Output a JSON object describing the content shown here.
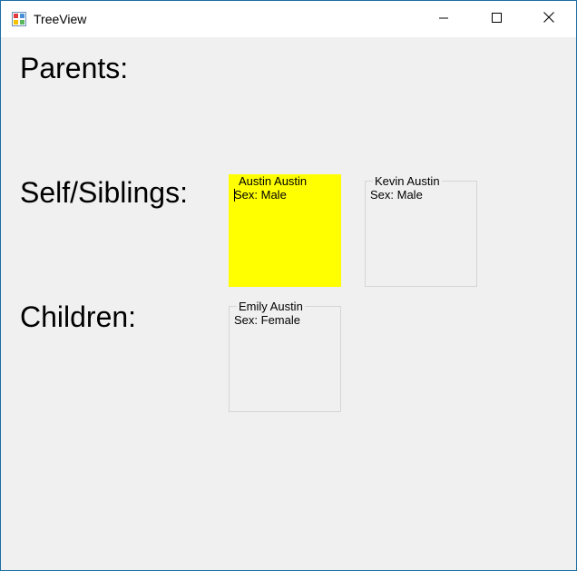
{
  "window": {
    "title": "TreeView",
    "icon": "winforms-app-icon",
    "buttons": {
      "minimize_icon": "minimize-icon",
      "maximize_icon": "maximize-icon",
      "close_icon": "close-icon"
    }
  },
  "labels": {
    "parents": "Parents:",
    "self_siblings": "Self/Siblings:",
    "children": "Children:"
  },
  "self_siblings": [
    {
      "name": "Austin Austin",
      "sex": "Sex: Male",
      "selected": true
    },
    {
      "name": "Kevin Austin",
      "sex": "Sex: Male",
      "selected": false
    }
  ],
  "children": [
    {
      "name": "Emily Austin",
      "sex": "Sex: Female",
      "selected": false
    }
  ],
  "colors": {
    "selected_background": "#ffff00",
    "window_background": "#f0f0f0",
    "group_border": "#d5d5d5",
    "window_border": "#1c6ea4"
  }
}
